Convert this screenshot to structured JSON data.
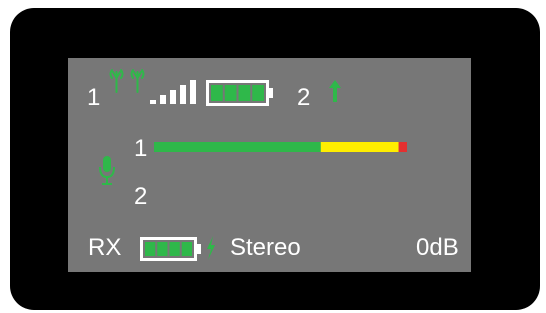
{
  "device": {
    "top_row": {
      "channel_1_label": "1",
      "channel_2_label": "2",
      "signal_bars": 5,
      "battery_segments": 4
    },
    "meter": {
      "channel_1_label": "1",
      "channel_2_label": "2",
      "channel_1_level_fraction": 0.91,
      "channel_2_level_fraction": 0
    },
    "bottom_row": {
      "rx_label": "RX",
      "mode_label": "Stereo",
      "gain_label": "0dB",
      "battery_segments": 4
    },
    "colors": {
      "screen_bg": "#777777",
      "bezel": "#000000",
      "text": "#ffffff",
      "accent_green": "#2fb84a",
      "meter_yellow": "#ffee00",
      "meter_red": "#e53030"
    },
    "icons": {
      "antenna": "dual-antenna-icon",
      "signal": "signal-strength-icon",
      "battery": "battery-icon",
      "up_arrow": "up-arrow-icon",
      "mic": "microphone-icon",
      "charge": "lightning-bolt-icon"
    }
  }
}
